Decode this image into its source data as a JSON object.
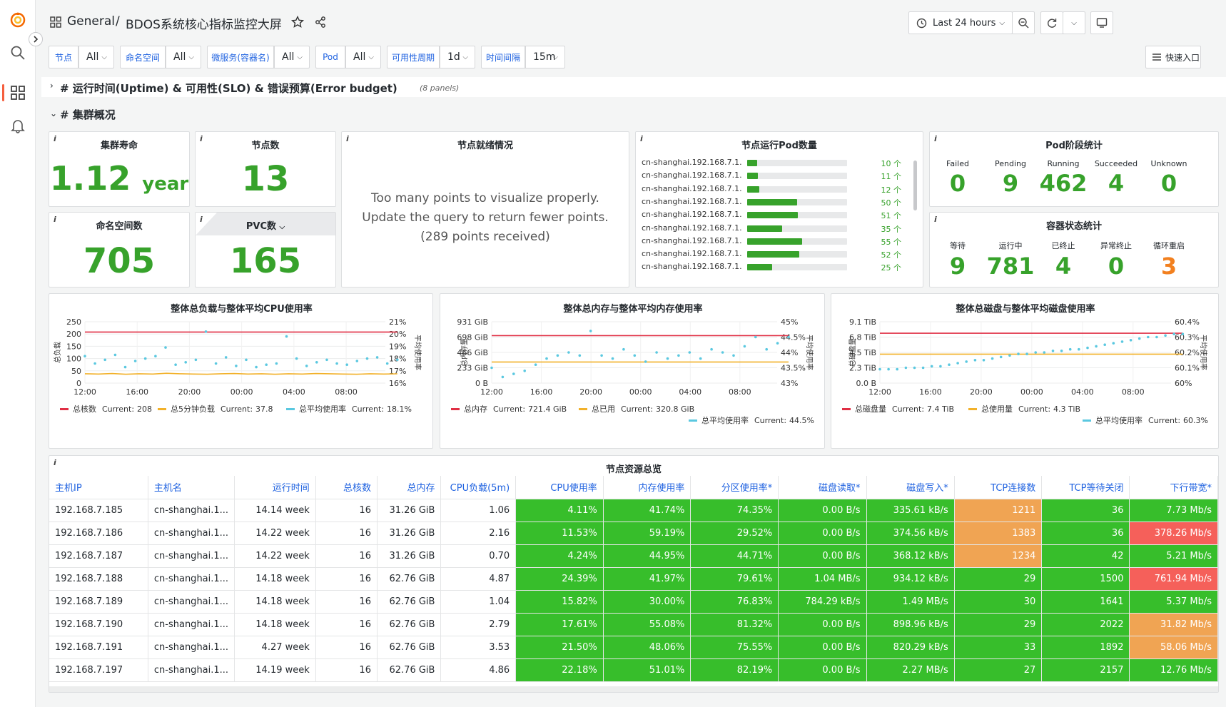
{
  "breadcrumb": {
    "section": "General",
    "separator": "/",
    "dashboard": "BDOS系统核心指标监控大屏"
  },
  "toolbar": {
    "time_range": "Last 24 hours"
  },
  "variables": [
    {
      "label": "节点",
      "value": "All"
    },
    {
      "label": "命名空间",
      "value": "All"
    },
    {
      "label": "微服务(容器名)",
      "value": "All"
    },
    {
      "label": "Pod",
      "value": "All"
    },
    {
      "label": "可用性周期",
      "value": "1d"
    },
    {
      "label": "时间间隔",
      "value": "15m"
    }
  ],
  "quick_entry": "快速入口",
  "rows": {
    "uptime": {
      "title": "# 运行时间(Uptime) & 可用性(SLO) & 错误预算(Error budget)",
      "panels": "(8 panels)"
    },
    "cluster": {
      "title": "# 集群概况"
    }
  },
  "info_icon": "i",
  "stats": {
    "cluster_life": {
      "title": "集群寿命",
      "value": "1.12",
      "unit": "year"
    },
    "node_count": {
      "title": "节点数",
      "value": "13"
    },
    "namespace_count": {
      "title": "命名空间数",
      "value": "705"
    },
    "pvc_count": {
      "title": "PVC数",
      "value": "165"
    }
  },
  "node_ready": {
    "title": "节点就绪情况",
    "message": [
      "Too many points to visualize properly.",
      "Update the query to return fewer points.",
      "(289 points received)"
    ]
  },
  "node_pods": {
    "title": "节点运行Pod数量",
    "max": 100,
    "items": [
      {
        "name": "cn-shanghai.192.168.7.1...",
        "value": 10,
        "label": "10 个"
      },
      {
        "name": "cn-shanghai.192.168.7.1...",
        "value": 11,
        "label": "11 个"
      },
      {
        "name": "cn-shanghai.192.168.7.1...",
        "value": 12,
        "label": "12 个"
      },
      {
        "name": "cn-shanghai.192.168.7.1...",
        "value": 50,
        "label": "50 个"
      },
      {
        "name": "cn-shanghai.192.168.7.1...",
        "value": 51,
        "label": "51 个"
      },
      {
        "name": "cn-shanghai.192.168.7.1...",
        "value": 35,
        "label": "35 个"
      },
      {
        "name": "cn-shanghai.192.168.7.1...",
        "value": 55,
        "label": "55 个"
      },
      {
        "name": "cn-shanghai.192.168.7.1...",
        "value": 52,
        "label": "52 个"
      },
      {
        "name": "cn-shanghai.192.168.7.1...",
        "value": 25,
        "label": "25 个"
      }
    ]
  },
  "pod_phase": {
    "title": "Pod阶段统计",
    "items": [
      {
        "label": "Failed",
        "value": "0"
      },
      {
        "label": "Pending",
        "value": "9"
      },
      {
        "label": "Running",
        "value": "462"
      },
      {
        "label": "Succeeded",
        "value": "4"
      },
      {
        "label": "Unknown",
        "value": "0"
      }
    ]
  },
  "container_state": {
    "title": "容器状态统计",
    "items": [
      {
        "label": "等待",
        "value": "9",
        "color": "#37a22b"
      },
      {
        "label": "运行中",
        "value": "781",
        "color": "#37a22b"
      },
      {
        "label": "已终止",
        "value": "4",
        "color": "#37a22b"
      },
      {
        "label": "异常终止",
        "value": "0",
        "color": "#37a22b"
      },
      {
        "label": "循环重启",
        "value": "3",
        "color": "#f2801f"
      }
    ]
  },
  "chart_data": [
    {
      "type": "line",
      "title": "整体总负载与整体平均CPU使用率",
      "ylabel": "总负载",
      "y2label": "平均使用率",
      "x_ticks": [
        "12:00",
        "16:00",
        "20:00",
        "00:00",
        "04:00",
        "08:00"
      ],
      "y_ticks": [
        "0",
        "50",
        "100",
        "150",
        "200",
        "250"
      ],
      "y2_ticks": [
        "16%",
        "17%",
        "18%",
        "19%",
        "20%",
        "21%"
      ],
      "ylim": [
        0,
        250
      ],
      "y2lim": [
        16,
        21
      ],
      "series": [
        {
          "name": "总核数",
          "axis": "left",
          "style": "line",
          "color": "#e02f44",
          "values": [
            208,
            208,
            208,
            208,
            208,
            208,
            208,
            208,
            208,
            208,
            208,
            208,
            208,
            208,
            208,
            208,
            208,
            208,
            208,
            208,
            208,
            208,
            208,
            208
          ],
          "current": "208"
        },
        {
          "name": "总5分钟负载",
          "axis": "left",
          "style": "line",
          "color": "#f2b12a",
          "values": [
            38,
            37,
            39,
            36,
            38,
            37,
            40,
            38,
            37,
            36,
            38,
            39,
            37,
            38,
            36,
            38,
            37,
            39,
            38,
            37,
            36,
            38,
            37,
            37.8
          ],
          "current": "37.8"
        },
        {
          "name": "总平均使用率",
          "axis": "right",
          "style": "points",
          "color": "#5ac8e0",
          "values": [
            18.2,
            17.6,
            17.9,
            18.3,
            17.3,
            17.8,
            18.0,
            18.2,
            18.9,
            17.5,
            17.7,
            17.9,
            20.2,
            17.6,
            18.1,
            17.4,
            17.9,
            17.3,
            17.5,
            17.6,
            19.8,
            18.0,
            17.4,
            17.7,
            17.9,
            17.6,
            17.5,
            17.8,
            18.0,
            18.1,
            17.6,
            17.9
          ],
          "current": "18.1%"
        }
      ],
      "legend_placement": "bottom"
    },
    {
      "type": "line",
      "title": "整体总内存与整体平均内存使用率",
      "ylabel": "总内存量",
      "y2label": "平均使用率",
      "x_ticks": [
        "12:00",
        "16:00",
        "20:00",
        "00:00",
        "04:00",
        "08:00"
      ],
      "y_ticks": [
        "0 B",
        "233 GiB",
        "466 GiB",
        "698 GiB",
        "931 GiB"
      ],
      "y2_ticks": [
        "43%",
        "43.5%",
        "44%",
        "44.5%",
        "45%"
      ],
      "ylim": [
        0,
        931
      ],
      "y2lim": [
        43,
        45
      ],
      "series": [
        {
          "name": "总内存",
          "axis": "left",
          "style": "line",
          "color": "#e02f44",
          "values": [
            721.4,
            721.4,
            721.4,
            721.4,
            721.4,
            721.4,
            721.4,
            721.4,
            721.4,
            721.4,
            721.4,
            721.4,
            721.4,
            721.4,
            721.4,
            721.4,
            721.4,
            721.4,
            721.4,
            721.4,
            721.4,
            721.4,
            721.4,
            721.4
          ],
          "current": "721.4 GiB"
        },
        {
          "name": "总已用",
          "axis": "left",
          "style": "line",
          "color": "#f2b12a",
          "values": [
            320.8,
            320.8,
            320.8,
            320.8,
            320.8,
            320.8,
            320.8,
            320.8,
            320.8,
            320.8,
            320.8,
            320.8,
            320.8,
            320.8,
            320.8,
            320.8,
            320.8,
            320.8,
            320.8,
            320.8,
            320.8,
            320.8,
            320.8,
            320.8
          ],
          "current": "320.8 GiB"
        },
        {
          "name": "总平均使用率",
          "axis": "right",
          "style": "points",
          "color": "#5ac8e0",
          "values": [
            43.5,
            43.2,
            43.3,
            43.4,
            43.6,
            43.8,
            43.9,
            44.0,
            43.9,
            44.7,
            43.9,
            43.8,
            44.1,
            43.9,
            43.7,
            44.0,
            43.8,
            43.9,
            44.0,
            43.8,
            44.1,
            44.0,
            43.9,
            44.2,
            44.5,
            44.1,
            44.3,
            44.5
          ],
          "current": "44.5%"
        }
      ],
      "legend_placement": "bottom"
    },
    {
      "type": "line",
      "title": "整体总磁盘与整体平均磁盘使用率",
      "ylabel": "总磁盘量",
      "y2label": "平均使用率",
      "x_ticks": [
        "12:00",
        "16:00",
        "20:00",
        "00:00",
        "04:00",
        "08:00"
      ],
      "y_ticks": [
        "0.0 B",
        "2.3 TiB",
        "4.5 TiB",
        "6.8 TiB",
        "9.1 TiB"
      ],
      "y2_ticks": [
        "60%",
        "60.1%",
        "60.2%",
        "60.3%",
        "60.4%"
      ],
      "ylim": [
        0,
        9.1
      ],
      "y2lim": [
        60,
        60.4
      ],
      "series": [
        {
          "name": "总磁盘量",
          "axis": "left",
          "style": "line",
          "color": "#e02f44",
          "values": [
            7.4,
            7.4,
            7.4,
            7.4,
            7.4,
            7.4,
            7.4,
            7.4,
            7.4,
            7.4,
            7.4,
            7.4,
            7.4,
            7.4,
            7.4,
            7.4,
            7.4,
            7.4,
            7.4,
            7.4,
            7.4,
            7.4,
            7.4,
            7.4
          ],
          "current": "7.4 TiB"
        },
        {
          "name": "总使用量",
          "axis": "left",
          "style": "line",
          "color": "#f2b12a",
          "values": [
            4.3,
            4.3,
            4.3,
            4.3,
            4.3,
            4.3,
            4.3,
            4.3,
            4.3,
            4.3,
            4.3,
            4.3,
            4.3,
            4.3,
            4.3,
            4.3,
            4.3,
            4.3,
            4.3,
            4.3,
            4.3,
            4.3,
            4.3,
            4.3
          ],
          "current": "4.3 TiB"
        },
        {
          "name": "总平均使用率",
          "axis": "right",
          "style": "points",
          "color": "#5ac8e0",
          "values": [
            60.09,
            60.09,
            60.09,
            60.1,
            60.1,
            60.1,
            60.11,
            60.11,
            60.12,
            60.13,
            60.14,
            60.15,
            60.15,
            60.16,
            60.17,
            60.18,
            60.19,
            60.19,
            60.2,
            60.2,
            60.21,
            60.21,
            60.22,
            60.22,
            60.23,
            60.24,
            60.25,
            60.26,
            60.27,
            60.28,
            60.29,
            60.3,
            60.3,
            60.31,
            60.32,
            60.32
          ],
          "current": "60.3%"
        }
      ],
      "legend_placement": "bottom"
    }
  ],
  "legend_current_label": "Current:",
  "node_table": {
    "title": "节点资源总览",
    "columns": [
      "主机IP",
      "主机名",
      "运行时间",
      "总核数",
      "总内存",
      "CPU负载(5m)",
      "CPU使用率",
      "内存使用率",
      "分区使用率*",
      "磁盘读取*",
      "磁盘写入*",
      "TCP连接数",
      "TCP等待关闭",
      "下行带宽*"
    ],
    "rows": [
      [
        "192.168.7.185",
        "cn-shanghai.1...",
        "14.14 week",
        "16",
        "31.26 GiB",
        "1.06",
        "4.11%",
        "41.74%",
        "74.35%",
        "0.00 B/s",
        "335.61 kB/s",
        "1211",
        "36",
        "7.73 Mb/s"
      ],
      [
        "192.168.7.186",
        "cn-shanghai.1...",
        "14.22 week",
        "16",
        "31.26 GiB",
        "2.16",
        "11.53%",
        "59.19%",
        "29.52%",
        "0.00 B/s",
        "374.56 kB/s",
        "1383",
        "36",
        "378.26 Mb/s"
      ],
      [
        "192.168.7.187",
        "cn-shanghai.1...",
        "14.22 week",
        "16",
        "31.26 GiB",
        "0.70",
        "4.24%",
        "44.95%",
        "44.71%",
        "0.00 B/s",
        "368.12 kB/s",
        "1234",
        "42",
        "5.21 Mb/s"
      ],
      [
        "192.168.7.188",
        "cn-shanghai.1...",
        "14.18 week",
        "16",
        "62.76 GiB",
        "4.87",
        "24.39%",
        "41.97%",
        "79.61%",
        "1.04 MB/s",
        "934.12 kB/s",
        "29",
        "1500",
        "761.94 Mb/s"
      ],
      [
        "192.168.7.189",
        "cn-shanghai.1...",
        "14.18 week",
        "16",
        "62.76 GiB",
        "1.04",
        "15.82%",
        "30.00%",
        "76.83%",
        "784.29 kB/s",
        "1.49 MB/s",
        "30",
        "1641",
        "5.37 Mb/s"
      ],
      [
        "192.168.7.190",
        "cn-shanghai.1...",
        "14.18 week",
        "16",
        "62.76 GiB",
        "2.79",
        "17.61%",
        "55.08%",
        "81.32%",
        "0.00 B/s",
        "898.96 kB/s",
        "29",
        "2022",
        "31.82 Mb/s"
      ],
      [
        "192.168.7.191",
        "cn-shanghai.1...",
        "4.27 week",
        "16",
        "62.76 GiB",
        "3.53",
        "21.50%",
        "48.06%",
        "75.55%",
        "0.00 B/s",
        "820.29 kB/s",
        "33",
        "1892",
        "58.06 Mb/s"
      ],
      [
        "192.168.7.197",
        "cn-shanghai.1...",
        "14.19 week",
        "16",
        "62.76 GiB",
        "4.86",
        "22.18%",
        "51.01%",
        "82.19%",
        "0.00 B/s",
        "2.27 MB/s",
        "27",
        "2157",
        "12.76 Mb/s"
      ]
    ],
    "cell_colors": [
      [
        "",
        "",
        "",
        "",
        "",
        "",
        "g",
        "g",
        "g",
        "g",
        "g",
        "o",
        "g",
        "g"
      ],
      [
        "",
        "",
        "",
        "",
        "",
        "",
        "g",
        "g",
        "g",
        "g",
        "g",
        "o",
        "g",
        "r"
      ],
      [
        "",
        "",
        "",
        "",
        "",
        "",
        "g",
        "g",
        "g",
        "g",
        "g",
        "o",
        "g",
        "g"
      ],
      [
        "",
        "",
        "",
        "",
        "",
        "",
        "g",
        "g",
        "g",
        "g",
        "g",
        "g",
        "g",
        "r"
      ],
      [
        "",
        "",
        "",
        "",
        "",
        "",
        "g",
        "g",
        "g",
        "g",
        "g",
        "g",
        "g",
        "g"
      ],
      [
        "",
        "",
        "",
        "",
        "",
        "",
        "g",
        "g",
        "g",
        "g",
        "g",
        "g",
        "g",
        "o"
      ],
      [
        "",
        "",
        "",
        "",
        "",
        "",
        "g",
        "g",
        "g",
        "g",
        "g",
        "g",
        "g",
        "o"
      ],
      [
        "",
        "",
        "",
        "",
        "",
        "",
        "g",
        "g",
        "g",
        "g",
        "g",
        "g",
        "g",
        "g"
      ]
    ]
  }
}
